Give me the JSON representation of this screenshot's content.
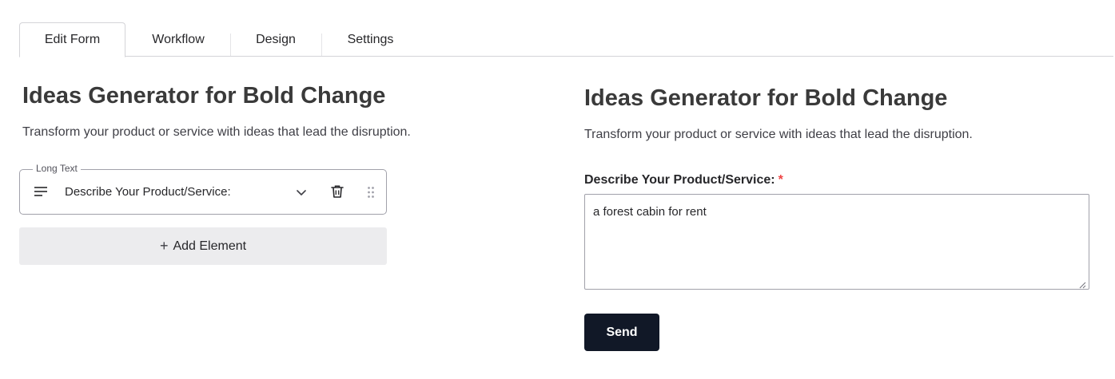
{
  "tabs": [
    {
      "label": "Edit Form",
      "active": true
    },
    {
      "label": "Workflow",
      "active": false
    },
    {
      "label": "Design",
      "active": false
    },
    {
      "label": "Settings",
      "active": false
    }
  ],
  "editor": {
    "title": "Ideas Generator for Bold Change",
    "description": "Transform your product or service with ideas that lead the disruption.",
    "field": {
      "type_legend": "Long Text",
      "label": "Describe Your Product/Service:",
      "type_icon": "lines-icon",
      "expand_icon": "chevron-down-icon",
      "delete_icon": "trash-icon",
      "drag_icon": "drag-handle-icon"
    },
    "add_element_label": "Add Element"
  },
  "preview": {
    "title": "Ideas Generator for Bold Change",
    "description": "Transform your product or service with ideas that lead the disruption.",
    "field_label": "Describe Your Product/Service:",
    "required_marker": "*",
    "field_value": "a forest cabin for rent",
    "submit_label": "Send"
  },
  "colors": {
    "submit_button": "#111827",
    "required": "#ef4444",
    "add_element_bg": "#ececee"
  }
}
